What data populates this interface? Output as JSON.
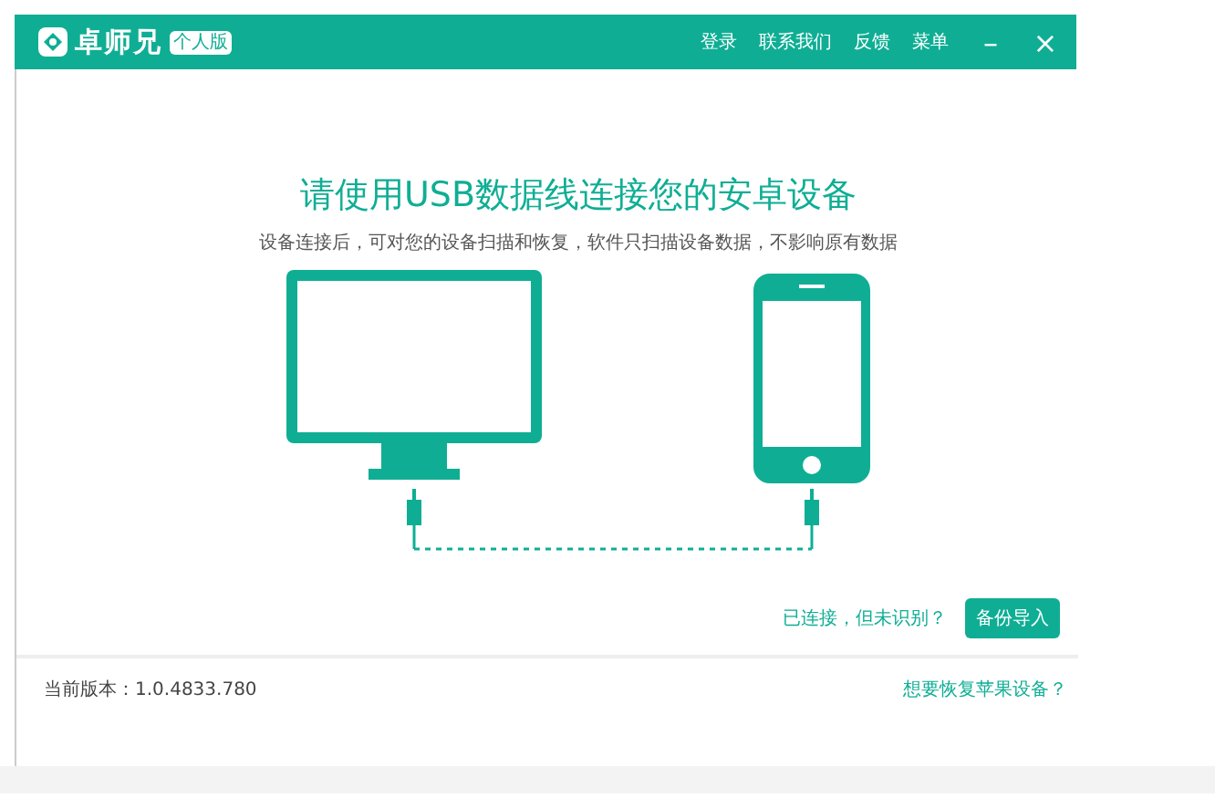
{
  "window": {
    "app_name": "卓师兄",
    "edition_badge": "个人版",
    "menu": [
      "登录",
      "联系我们",
      "反馈",
      "菜单"
    ],
    "minimize": "–",
    "close": "×"
  },
  "main": {
    "heading": "请使用USB数据线连接您的安卓设备",
    "subtitle": "设备连接后，可对您的设备扫描和恢复，软件只扫描设备数据，不影响原有数据"
  },
  "actions": {
    "help_link": "已连接，但未识别？",
    "button": "备份导入"
  },
  "footer": {
    "version": "当前版本：1.0.4833.780",
    "link": "想要恢复苹果设备？"
  }
}
